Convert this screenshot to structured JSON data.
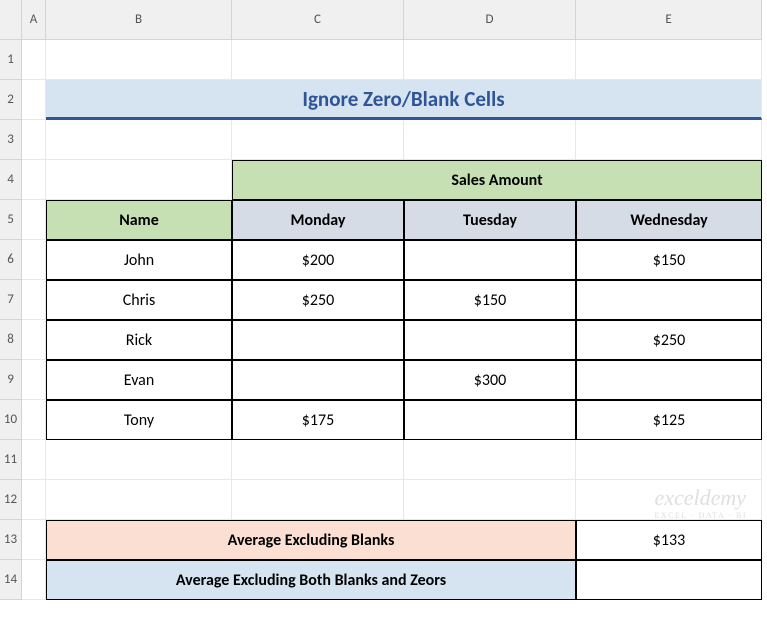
{
  "columns": [
    "A",
    "B",
    "C",
    "D",
    "E"
  ],
  "rowcount": 14,
  "title": "Ignore Zero/Blank Cells",
  "salesHeader": "Sales Amount",
  "nameHeader": "Name",
  "dayHeaders": [
    "Monday",
    "Tuesday",
    "Wednesday"
  ],
  "people": [
    {
      "name": "John",
      "mon": "$200",
      "tue": "",
      "wed": "$150"
    },
    {
      "name": "Chris",
      "mon": "$250",
      "tue": "$150",
      "wed": ""
    },
    {
      "name": "Rick",
      "mon": "",
      "tue": "",
      "wed": "$250"
    },
    {
      "name": "Evan",
      "mon": "",
      "tue": "$300",
      "wed": ""
    },
    {
      "name": "Tony",
      "mon": "$175",
      "tue": "",
      "wed": "$125"
    }
  ],
  "avgBlanksLabel": "Average Excluding Blanks",
  "avgBlanksVal": "$133",
  "avgBothLabel": "Average Excluding Both Blanks and Zeors",
  "avgBothVal": "",
  "watermark": "exceldemy",
  "watermarkSub": "EXCEL · DATA · BI",
  "chart_data": {
    "type": "table",
    "title": "Ignore Zero/Blank Cells",
    "columns": [
      "Name",
      "Monday",
      "Tuesday",
      "Wednesday"
    ],
    "rows": [
      [
        "John",
        200,
        null,
        150
      ],
      [
        "Chris",
        250,
        150,
        null
      ],
      [
        "Rick",
        null,
        null,
        250
      ],
      [
        "Evan",
        null,
        300,
        null
      ],
      [
        "Tony",
        175,
        null,
        125
      ]
    ],
    "summaries": [
      {
        "label": "Average Excluding Blanks",
        "value": 133
      },
      {
        "label": "Average Excluding Both Blanks and Zeors",
        "value": null
      }
    ]
  }
}
